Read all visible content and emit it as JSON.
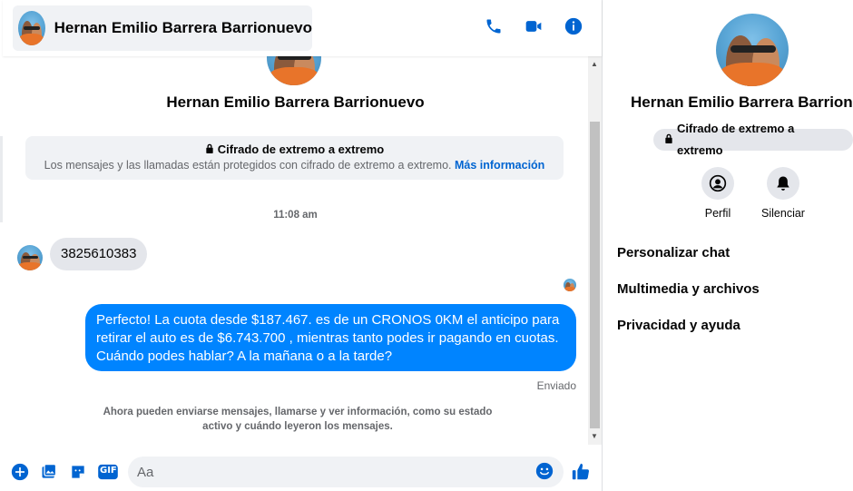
{
  "contact": {
    "name": "Hernan Emilio Barrera Barrionuevo"
  },
  "header": {
    "icons": [
      "phone-icon",
      "video-icon",
      "info-icon"
    ]
  },
  "conversation": {
    "e2e_title": "Cifrado de extremo a extremo",
    "e2e_text": "Los mensajes y las llamadas están protegidos con cifrado de extremo a extremo.",
    "e2e_link": "Más información",
    "timestamp": "11:08 am",
    "incoming_message": "3825610383",
    "outgoing_message": "Perfecto! La cuota desde $187.467. es de un CRONOS 0KM el anticipo para retirar el auto es de $6.743.700 , mientras tanto podes ir pagando en cuotas. Cuándo podes hablar? A la mañana o a la tarde?",
    "sent_status": "Enviado",
    "info_note": "Ahora pueden enviarse mensajes, llamarse y ver información, como su estado activo y cuándo leyeron los mensajes."
  },
  "composer": {
    "placeholder": "Aa",
    "icons": [
      "plus-icon",
      "image-icon",
      "sticker-icon",
      "gif-icon",
      "emoji-icon",
      "like-icon"
    ],
    "gif_label": "GIF"
  },
  "info_pane": {
    "e2e_pill": "Cifrado de extremo a extremo",
    "actions": [
      {
        "label": "Perfil",
        "icon": "profile-icon"
      },
      {
        "label": "Silenciar",
        "icon": "bell-icon"
      }
    ],
    "menu": [
      "Personalizar chat",
      "Multimedia y archivos",
      "Privacidad y ayuda"
    ]
  },
  "colors": {
    "accent": "#0084ff",
    "icon_blue": "#0064d1",
    "bubble_gray": "#e4e6eb",
    "muted_text": "#65676b"
  }
}
